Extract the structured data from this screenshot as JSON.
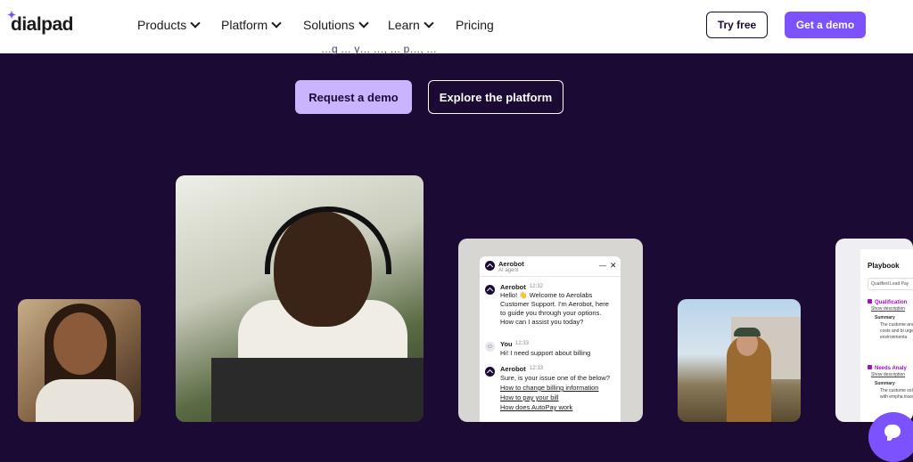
{
  "header": {
    "logo": "dialpad",
    "nav": [
      "Products",
      "Platform",
      "Solutions",
      "Learn",
      "Pricing"
    ],
    "try_free": "Try free",
    "get_demo": "Get a demo"
  },
  "hero": {
    "subline": "…g … y… …, … p…, …",
    "request_demo": "Request a demo",
    "explore_platform": "Explore the platform"
  },
  "chat_widget": {
    "bot_name": "Aerobot",
    "bot_sub": "AI agent",
    "messages": [
      {
        "sender": "Aerobot",
        "time": "12:32",
        "text": "Hello! 👋 Welcome to Aerolabs Customer Support. I'm Aerobot, here to guide you through your options. How can I assist you today?"
      },
      {
        "sender": "You",
        "time": "12:33",
        "text": "Hi! I need support about billing"
      },
      {
        "sender": "Aerobot",
        "time": "12:33",
        "text": "Sure, is your issue one of the below?"
      }
    ],
    "links": [
      "How to change billing information",
      "How to pay your bill",
      "How does AutoPay work"
    ]
  },
  "playbook": {
    "title": "Playbook",
    "select_value": "Qualified Lead Pay",
    "sections": [
      {
        "title": "Qualification",
        "show": "Show description",
        "summary": "Summary",
        "text": "The custome and ineffici costs and bi urgency to a environmenta"
      },
      {
        "title": "Needs Analy",
        "show": "Show description",
        "summary": "Summary",
        "text": "The custome solutions for with empha traceability t"
      }
    ]
  },
  "colors": {
    "accent": "#7c52ff",
    "bg": "#1b0a33",
    "cta_light": "#c9b5ff"
  },
  "icons": {
    "chat_fab": "chat-bubble-icon",
    "nav_chevron": "chevron-down-icon"
  }
}
